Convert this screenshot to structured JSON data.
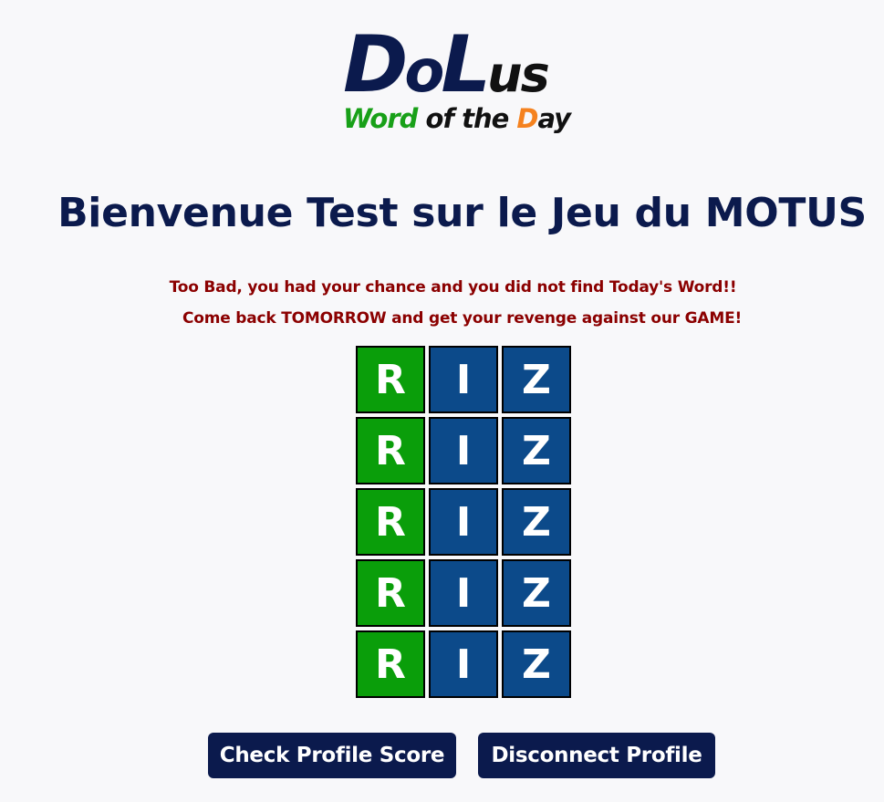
{
  "logo": {
    "title_big1": "D",
    "title_small1": "o",
    "title_big2": "L",
    "title_small2": "us",
    "subtitle_parts": [
      "W",
      "ord",
      " of ",
      "the",
      " D",
      "ay"
    ]
  },
  "header": {
    "welcome": "Bienvenue Test sur le Jeu du MOTUS"
  },
  "messages": {
    "line1": "Too Bad, you had your chance and you did not find Today's Word!!",
    "line2": "Come back TOMORROW and get your revenge against our GAME!"
  },
  "board": {
    "rows": [
      [
        {
          "letter": "R",
          "state": "correct"
        },
        {
          "letter": "I",
          "state": "absent"
        },
        {
          "letter": "Z",
          "state": "absent"
        }
      ],
      [
        {
          "letter": "R",
          "state": "correct"
        },
        {
          "letter": "I",
          "state": "absent"
        },
        {
          "letter": "Z",
          "state": "absent"
        }
      ],
      [
        {
          "letter": "R",
          "state": "correct"
        },
        {
          "letter": "I",
          "state": "absent"
        },
        {
          "letter": "Z",
          "state": "absent"
        }
      ],
      [
        {
          "letter": "R",
          "state": "correct"
        },
        {
          "letter": "I",
          "state": "absent"
        },
        {
          "letter": "Z",
          "state": "absent"
        }
      ],
      [
        {
          "letter": "R",
          "state": "correct"
        },
        {
          "letter": "I",
          "state": "absent"
        },
        {
          "letter": "Z",
          "state": "absent"
        }
      ]
    ]
  },
  "buttons": {
    "check_score": "Check Profile Score",
    "disconnect": "Disconnect Profile"
  },
  "colors": {
    "primary_navy": "#0b1a4d",
    "tile_correct": "#0a9e0a",
    "tile_absent": "#0c4a8a",
    "message_red": "#8b0000",
    "logo_green": "#18a018",
    "logo_orange": "#f5821f"
  }
}
